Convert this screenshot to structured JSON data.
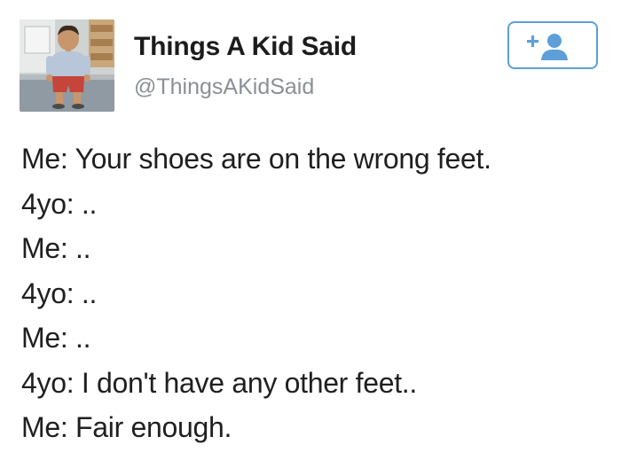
{
  "tweet": {
    "author": {
      "display_name": "Things A Kid Said",
      "handle": "@ThingsAKidSaid",
      "avatar": "profile-photo"
    },
    "follow_button": {
      "icon": "add-user-icon",
      "accent_color": "#5d9fd8"
    },
    "lines": [
      "Me: Your shoes are on the wrong feet.",
      "4yo: ..",
      "Me: ..",
      "4yo: ..",
      "Me: ..",
      "4yo: I don't have any other feet..",
      "Me: Fair enough."
    ]
  }
}
